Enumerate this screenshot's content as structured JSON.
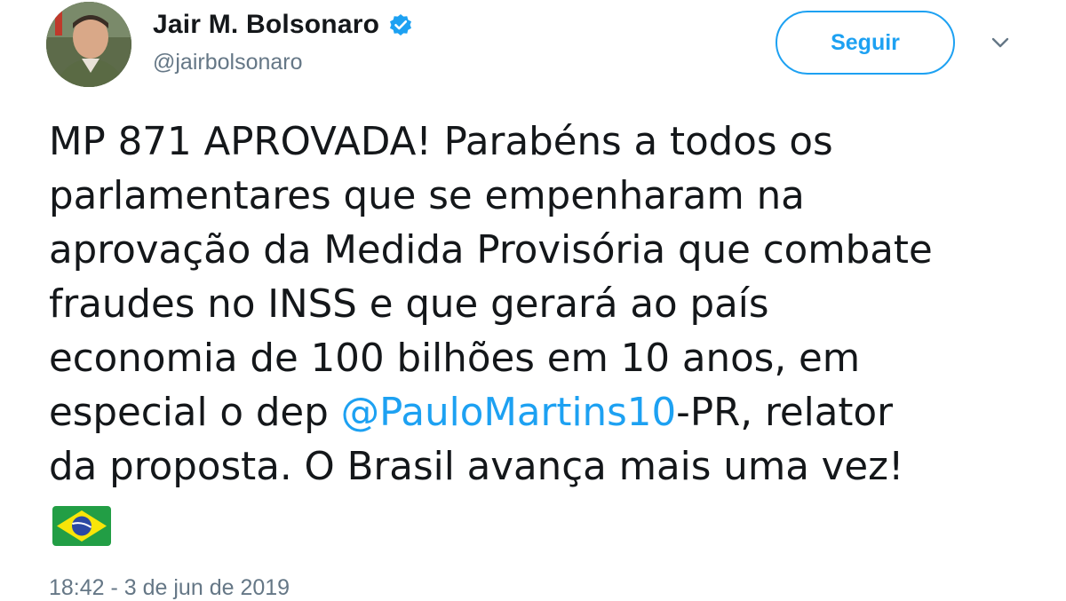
{
  "author": {
    "display_name": "Jair M. Bolsonaro",
    "handle": "@jairbolsonaro",
    "verified": true,
    "avatar_icon": "user-avatar-photo"
  },
  "header": {
    "follow_label": "Seguir",
    "caret_icon": "chevron-down-icon"
  },
  "tweet": {
    "lines": [
      "MP 871 APROVADA! Parabéns a todos os",
      "parlamentares que se empenharam na",
      "aprovação da Medida Provisória que combate",
      "fraudes no INSS e que gerará ao país",
      "economia de 100 bilhões em 10 anos, em"
    ],
    "line6_before": "especial o dep ",
    "mention": "@PauloMartins10",
    "line6_after": "-PR, relator",
    "line7": "da proposta. O Brasil avança mais uma vez!",
    "emoji": "brazil-flag-icon"
  },
  "meta": {
    "timestamp": "18:42 - 3 de jun de 2019"
  },
  "colors": {
    "accent": "#1da1f2",
    "text": "#14171a",
    "secondary": "#657786"
  }
}
